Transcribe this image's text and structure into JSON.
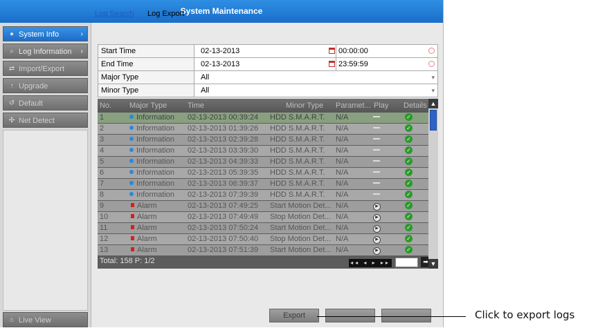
{
  "window": {
    "title": "System Maintenance"
  },
  "sidebar": {
    "items": [
      {
        "label": "System Info",
        "icon": "info-icon"
      },
      {
        "label": "Log Information",
        "icon": "search-icon"
      },
      {
        "label": "Import/Export",
        "icon": "import-export-icon"
      },
      {
        "label": "Upgrade",
        "icon": "upgrade-icon"
      },
      {
        "label": "Default",
        "icon": "default-icon"
      },
      {
        "label": "Net Detect",
        "icon": "net-detect-icon"
      }
    ],
    "live_view": "Live View"
  },
  "tabs": {
    "log_search": "Log Search",
    "log_export": "Log Export"
  },
  "form": {
    "start_time_label": "Start Time",
    "start_date": "02-13-2013",
    "start_time": "00:00:00",
    "end_time_label": "End Time",
    "end_date": "02-13-2013",
    "end_time": "23:59:59",
    "major_type_label": "Major Type",
    "major_type": "All",
    "minor_type_label": "Minor Type",
    "minor_type": "All"
  },
  "table": {
    "columns": {
      "no": "No.",
      "major": "Major Type",
      "time": "Time",
      "minor": "Minor Type",
      "param": "Paramet...",
      "play": "Play",
      "details": "Details"
    },
    "rows": [
      {
        "no": "1",
        "major": "Information",
        "type": "info",
        "time": "02-13-2013 00:39:24",
        "minor": "HDD S.M.A.R.T.",
        "param": "N/A",
        "play": false
      },
      {
        "no": "2",
        "major": "Information",
        "type": "info",
        "time": "02-13-2013 01:39:26",
        "minor": "HDD S.M.A.R.T.",
        "param": "N/A",
        "play": false
      },
      {
        "no": "3",
        "major": "Information",
        "type": "info",
        "time": "02-13-2013 02:39:28",
        "minor": "HDD S.M.A.R.T.",
        "param": "N/A",
        "play": false
      },
      {
        "no": "4",
        "major": "Information",
        "type": "info",
        "time": "02-13-2013 03:39:30",
        "minor": "HDD S.M.A.R.T.",
        "param": "N/A",
        "play": false
      },
      {
        "no": "5",
        "major": "Information",
        "type": "info",
        "time": "02-13-2013 04:39:33",
        "minor": "HDD S.M.A.R.T.",
        "param": "N/A",
        "play": false
      },
      {
        "no": "6",
        "major": "Information",
        "type": "info",
        "time": "02-13-2013 05:39:35",
        "minor": "HDD S.M.A.R.T.",
        "param": "N/A",
        "play": false
      },
      {
        "no": "7",
        "major": "Information",
        "type": "info",
        "time": "02-13-2013 06:39:37",
        "minor": "HDD S.M.A.R.T.",
        "param": "N/A",
        "play": false
      },
      {
        "no": "8",
        "major": "Information",
        "type": "info",
        "time": "02-13-2013 07:39:39",
        "minor": "HDD S.M.A.R.T.",
        "param": "N/A",
        "play": false
      },
      {
        "no": "9",
        "major": "Alarm",
        "type": "alarm",
        "time": "02-13-2013 07:49:25",
        "minor": "Start Motion Det...",
        "param": "N/A",
        "play": true
      },
      {
        "no": "10",
        "major": "Alarm",
        "type": "alarm",
        "time": "02-13-2013 07:49:49",
        "minor": "Stop Motion Det...",
        "param": "N/A",
        "play": true
      },
      {
        "no": "11",
        "major": "Alarm",
        "type": "alarm",
        "time": "02-13-2013 07:50:24",
        "minor": "Start Motion Det...",
        "param": "N/A",
        "play": true
      },
      {
        "no": "12",
        "major": "Alarm",
        "type": "alarm",
        "time": "02-13-2013 07:50:40",
        "minor": "Stop Motion Det...",
        "param": "N/A",
        "play": true
      },
      {
        "no": "13",
        "major": "Alarm",
        "type": "alarm",
        "time": "02-13-2013 07:51:39",
        "minor": "Start Motion Det...",
        "param": "N/A",
        "play": true
      }
    ],
    "total": "Total: 158  P: 1/2"
  },
  "buttons": {
    "export": "Export"
  },
  "callout": "Click to export logs"
}
